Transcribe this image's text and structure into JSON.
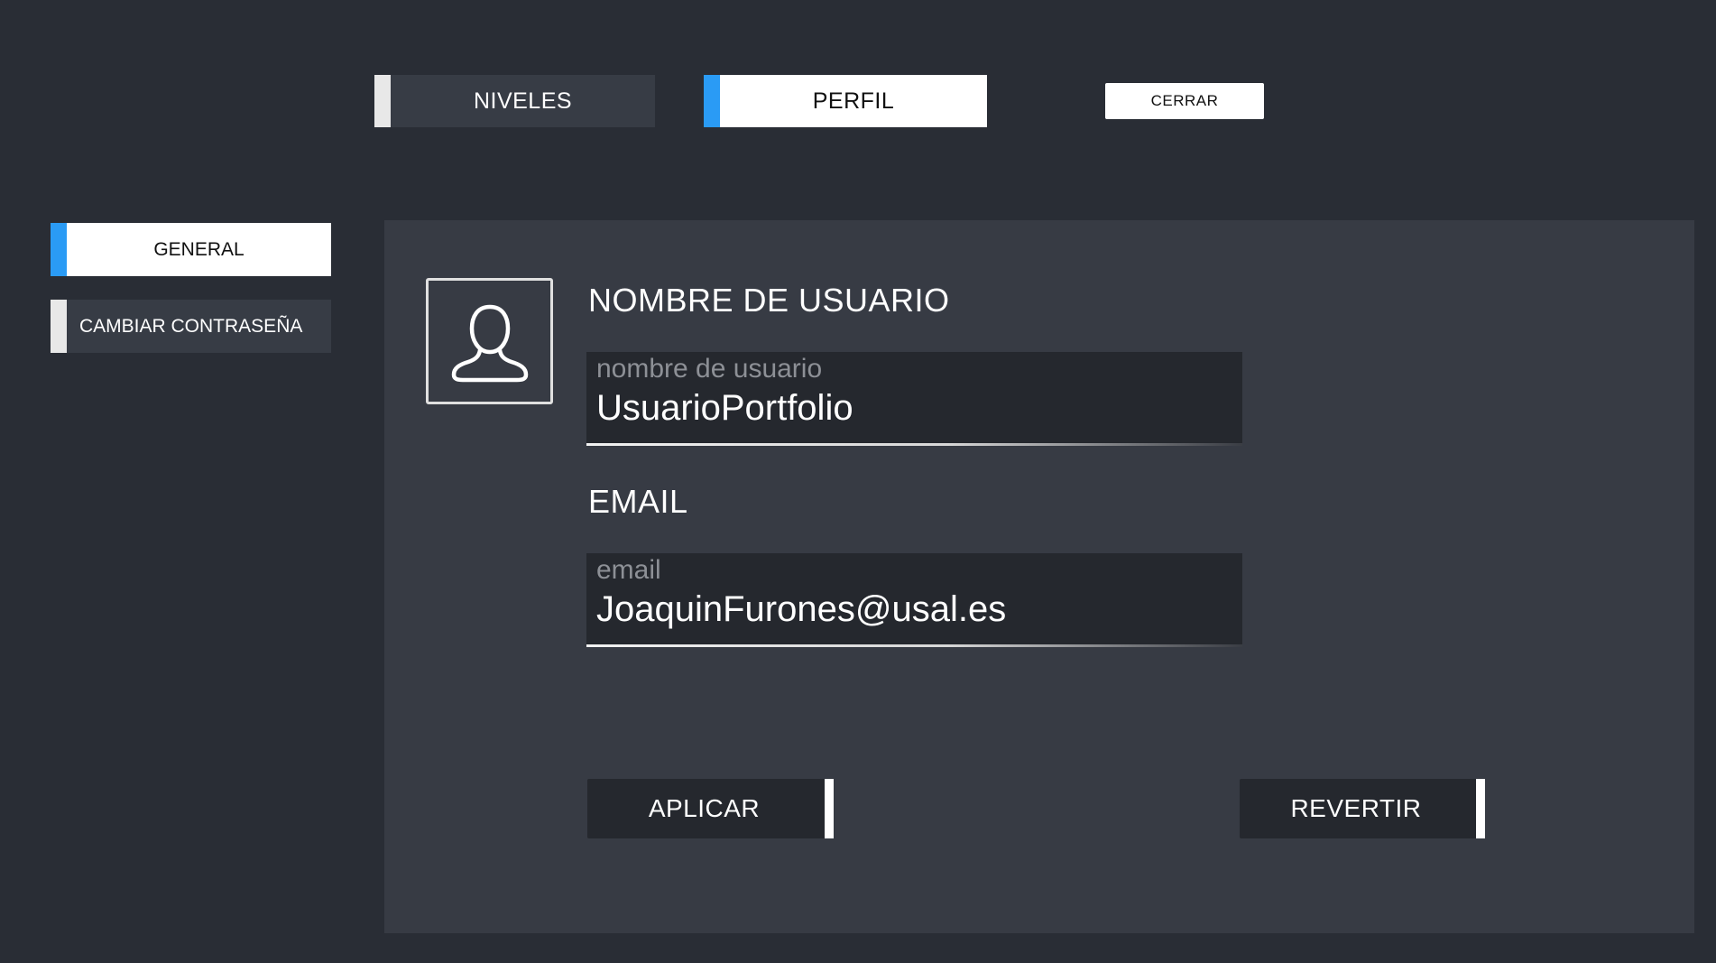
{
  "top_tabs": [
    {
      "label": "NIVELES",
      "active": false
    },
    {
      "label": "PERFIL",
      "active": true
    }
  ],
  "close_label": "CERRAR",
  "sidebar": {
    "items": [
      {
        "label": "GENERAL",
        "active": true
      },
      {
        "label": "CAMBIAR CONTRASEÑA",
        "active": false
      }
    ]
  },
  "profile": {
    "avatar_icon": "user-silhouette-icon",
    "username": {
      "heading": "NOMBRE DE USUARIO",
      "placeholder": "nombre de usuario",
      "value": "UsuarioPortfolio"
    },
    "email": {
      "heading": "EMAIL",
      "placeholder": "email",
      "value": "JoaquinFurones@usal.es"
    }
  },
  "actions": {
    "apply_label": "APLICAR",
    "revert_label": "REVERTIR"
  },
  "colors": {
    "background": "#292d35",
    "panel": "#373b44",
    "accent": "#2a9bf5",
    "field": "#25282e"
  }
}
